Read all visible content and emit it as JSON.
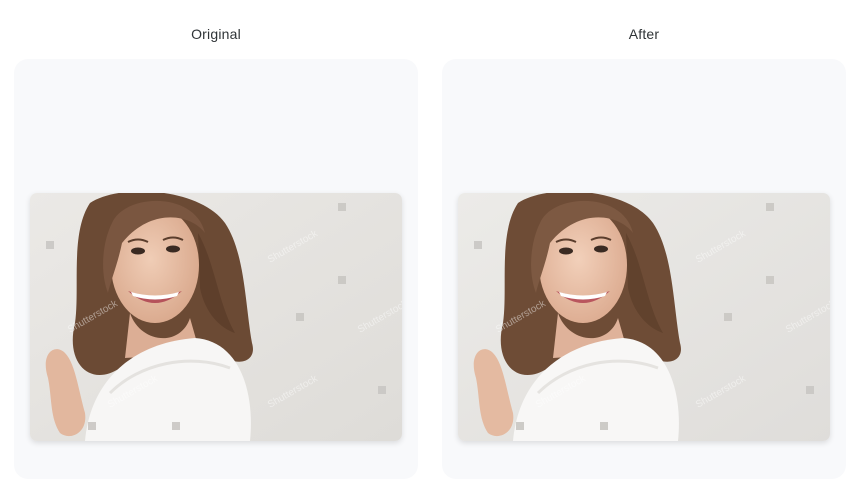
{
  "comparison": {
    "original": {
      "label": "Original",
      "image_alt": "smiling woman portrait"
    },
    "after": {
      "label": "After",
      "image_alt": "smiling woman portrait (enhanced)"
    }
  },
  "colors": {
    "panel_bg": "#f8f9fb",
    "label_text": "#2f3437",
    "backdrop": "#e6e4e1",
    "hair": "#6b4a34",
    "skin": "#e9c2aa",
    "shirt": "#f7f6f5"
  },
  "watermark": {
    "text": "Shutterstock"
  }
}
